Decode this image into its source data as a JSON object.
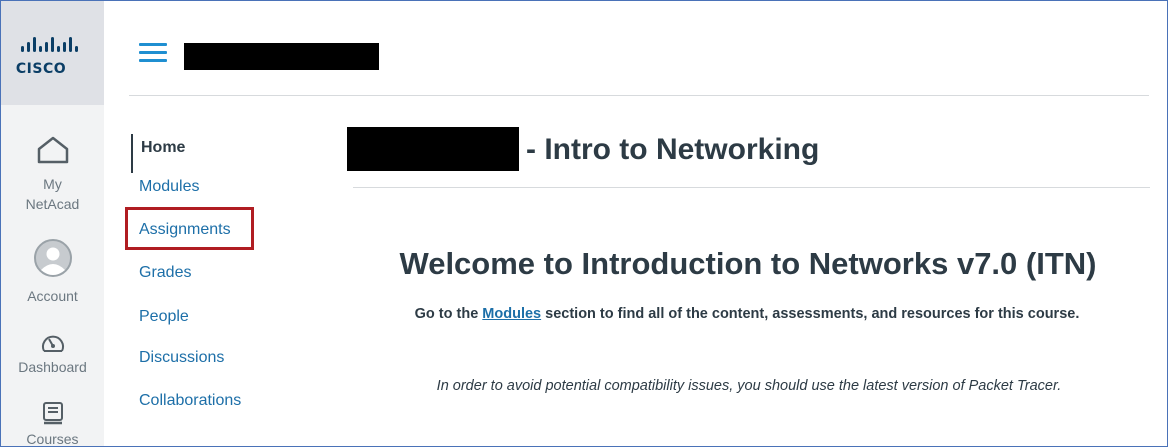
{
  "global_nav": {
    "logo_text": "cisco",
    "items": [
      {
        "label_line1": "My",
        "label_line2": "NetAcad",
        "icon": "home-icon"
      },
      {
        "label": "Account",
        "icon": "avatar-icon"
      },
      {
        "label": "Dashboard",
        "icon": "dashboard-icon"
      },
      {
        "label": "Courses",
        "icon": "courses-icon"
      }
    ]
  },
  "course_nav": {
    "items": [
      "Home",
      "Modules",
      "Assignments",
      "Grades",
      "People",
      "Discussions",
      "Collaborations"
    ],
    "active": "Home",
    "highlighted": "Assignments"
  },
  "main": {
    "course_title_suffix": "- Intro to Networking",
    "welcome_heading": "Welcome to Introduction to Networks v7.0 (ITN)",
    "para1_prefix": "Go to the ",
    "para1_link": "Modules",
    "para1_suffix": " section to find all of the content, assessments, and resources for this course.",
    "para2": "In order to avoid potential compatibility issues, you should use the latest version of Packet Tracer."
  },
  "colors": {
    "link": "#1d6fa8",
    "highlight_border": "#b01d22",
    "hamburger": "#1f8fd1",
    "brand_navy": "#0b3e66"
  }
}
